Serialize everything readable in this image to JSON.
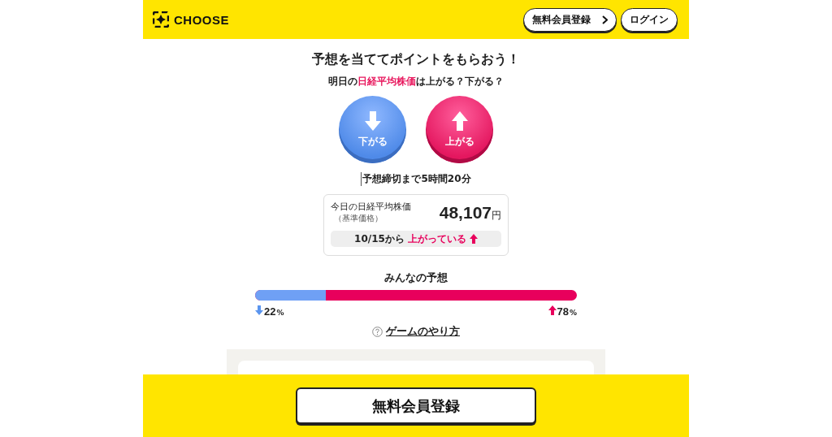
{
  "header": {
    "logo": "CHOOSE",
    "buttons": [
      {
        "label": "無料会員登録",
        "kind": "chevron"
      },
      {
        "label": "ログイン",
        "kind": "plain"
      }
    ]
  },
  "title": "予想を当ててポイントをもらおう！",
  "question": {
    "before": "明日の",
    "highlight": "日経平均株価",
    "after": "は上がる？下がる？"
  },
  "choices": [
    {
      "label": "下がる",
      "kind": "down"
    },
    {
      "label": "上がる",
      "kind": "up"
    }
  ],
  "deadline": "予想締切まで5時間20分",
  "price": {
    "label": "今日の日経平均株価",
    "sublabel": "（基準価格）",
    "value": "48,107",
    "unit": "円",
    "since": "10/15から",
    "trend": {
      "text": "上がっている",
      "kind": "up"
    }
  },
  "poll": {
    "title": "みんなの予想",
    "level": 0.22,
    "down": {
      "value": "22",
      "unit": "%"
    },
    "up": {
      "value": "78",
      "unit": "%"
    }
  },
  "help_link": "ゲームのやり方",
  "footer_button": "無料会員登録"
}
